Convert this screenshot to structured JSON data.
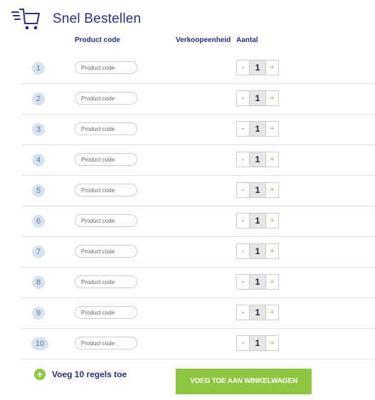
{
  "header": {
    "title": "Snel Bestellen",
    "icon": "quick-cart-icon"
  },
  "columns": {
    "product_code": "Product code",
    "unit": "Verkoopeenheid",
    "quantity": "Aantal"
  },
  "rows": [
    {
      "number": "1",
      "placeholder": "Product code",
      "quantity": "1"
    },
    {
      "number": "2",
      "placeholder": "Product code",
      "quantity": "1"
    },
    {
      "number": "3",
      "placeholder": "Product code",
      "quantity": "1"
    },
    {
      "number": "4",
      "placeholder": "Product code",
      "quantity": "1"
    },
    {
      "number": "5",
      "placeholder": "Product code",
      "quantity": "1"
    },
    {
      "number": "6",
      "placeholder": "Product code",
      "quantity": "1"
    },
    {
      "number": "7",
      "placeholder": "Product code",
      "quantity": "1"
    },
    {
      "number": "8",
      "placeholder": "Product code",
      "quantity": "1"
    },
    {
      "number": "9",
      "placeholder": "Product code",
      "quantity": "1"
    },
    {
      "number": "10",
      "placeholder": "Product code",
      "quantity": "1"
    }
  ],
  "stepper": {
    "minus": "-",
    "plus": "+"
  },
  "actions": {
    "add_rows_icon": "+",
    "add_rows": "Voeg 10 regels toe",
    "add_to_cart": "VOEG TOE AAN WINKELWAGEN"
  },
  "colors": {
    "primary": "#2b2e83",
    "accent": "#8dc63f",
    "row_badge": "#d6e4f0",
    "divider": "#dfe2e8"
  }
}
